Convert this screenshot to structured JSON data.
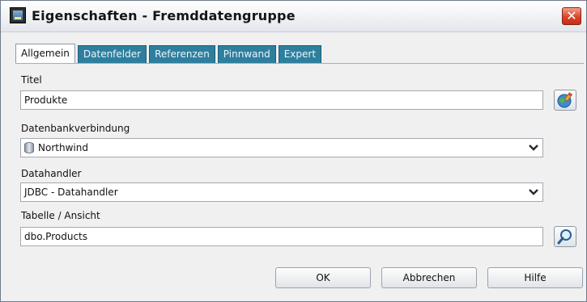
{
  "window": {
    "title": "Eigenschaften - Fremddatengruppe",
    "app_icon": "table-app-icon",
    "close_icon": "close-icon"
  },
  "tabs": [
    {
      "label": "Allgemein",
      "active": true
    },
    {
      "label": "Datenfelder",
      "active": false
    },
    {
      "label": "Referenzen",
      "active": false
    },
    {
      "label": "Pinnwand",
      "active": false
    },
    {
      "label": "Expert",
      "active": false
    }
  ],
  "form": {
    "titel_label": "Titel",
    "titel_value": "Produkte",
    "titel_action_icon": "globe-pencil-icon",
    "db_label": "Datenbankverbindung",
    "db_value": "Northwind",
    "db_icon": "database-icon",
    "handler_label": "Datahandler",
    "handler_value": "JDBC - Datahandler",
    "table_label": "Tabelle / Ansicht",
    "table_value": "dbo.Products",
    "table_action_icon": "magnifier-icon"
  },
  "buttons": {
    "ok": "OK",
    "cancel": "Abbrechen",
    "help": "Hilfe"
  },
  "colors": {
    "tab_inactive": "#2e7f9e",
    "close_button": "#d9452a"
  }
}
